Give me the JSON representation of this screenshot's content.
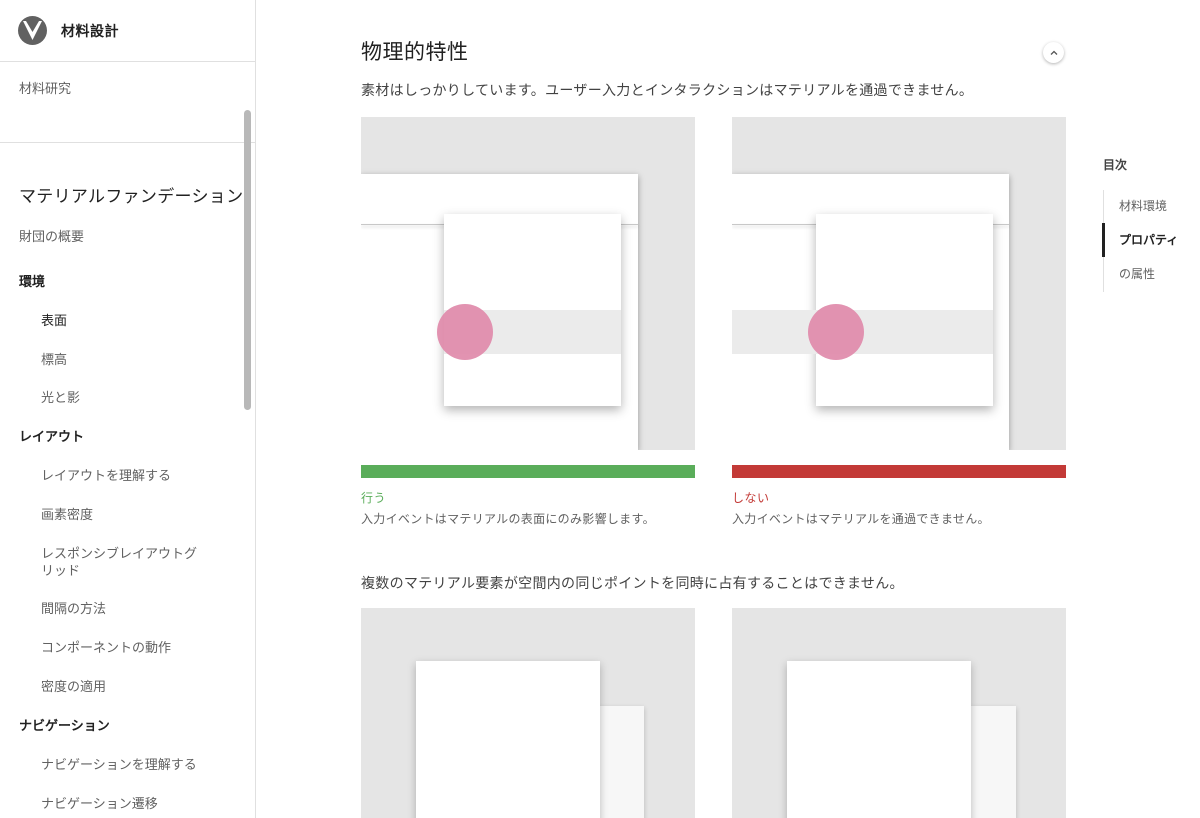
{
  "app": {
    "title": "材料設計",
    "logo": "material-logo-icon"
  },
  "sidebar": {
    "research": "材料研究",
    "section_title": "マテリアルファンデーション",
    "items": [
      {
        "label": "財団の概要"
      },
      {
        "label": "環境"
      },
      {
        "label": "表面"
      },
      {
        "label": "標高"
      },
      {
        "label": "光と影"
      },
      {
        "label": "レイアウト"
      },
      {
        "label": "レイアウトを理解する"
      },
      {
        "label": "画素密度"
      },
      {
        "label": "レスポンシブレイアウトグリッド"
      },
      {
        "label": "間隔の方法"
      },
      {
        "label": "コンポーネントの動作"
      },
      {
        "label": "密度の適用"
      },
      {
        "label": "ナビゲーション"
      },
      {
        "label": "ナビゲーションを理解する"
      },
      {
        "label": "ナビゲーション遷移"
      }
    ]
  },
  "main": {
    "section_title": "物理的特性",
    "collapse_icon": "chevron-up-icon",
    "description_1": "素材はしっかりしています。ユーザー入力とインタラクションはマテリアルを通過できません。",
    "do": {
      "label": "行う",
      "text": "入力イベントはマテリアルの表面にのみ影響します。",
      "color": "#5aad5a"
    },
    "dont": {
      "label": "しない",
      "text": "入力イベントはマテリアルを通過できません。",
      "color": "#c33a37"
    },
    "description_2": "複数のマテリアル要素が空間内の同じポイントを同時に占有することはできません。",
    "touch_color": "#e08aaa"
  },
  "toc": {
    "title": "目次",
    "items": [
      {
        "label": "材料環境"
      },
      {
        "label": "プロパティ"
      },
      {
        "label": "の属性"
      }
    ]
  }
}
